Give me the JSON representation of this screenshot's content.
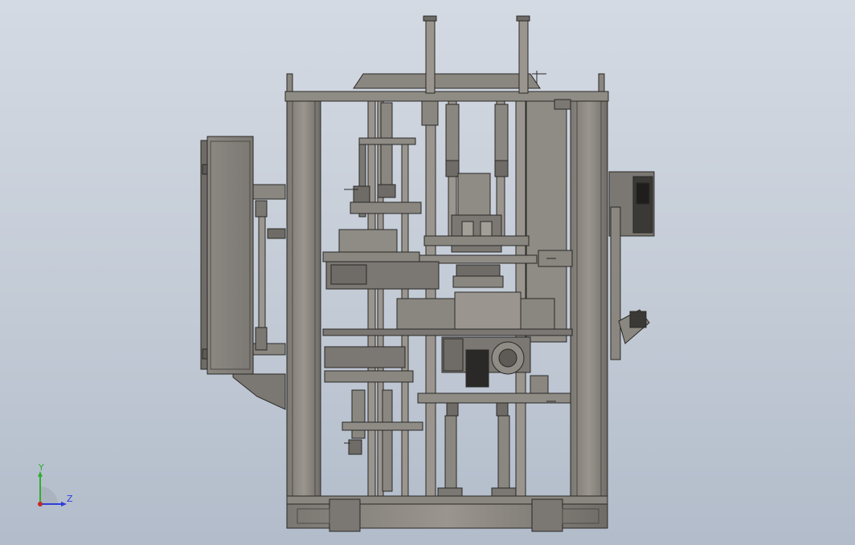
{
  "viewport": {
    "background_top": "#d4dae3",
    "background_bottom": "#b2bcca",
    "model_color": "#8a8680",
    "model_dark": "#5e5b57",
    "model_edge": "#2a2927",
    "model_light": "#a29e98"
  },
  "triad": {
    "y_label": "Y",
    "z_label": "Z",
    "y_color": "#2fae2f",
    "z_color": "#2f3fd8",
    "origin_color": "#c22b2b"
  }
}
